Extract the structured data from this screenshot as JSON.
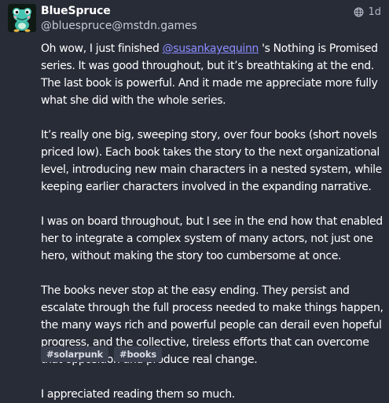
{
  "author": {
    "display_name": "BlueSpruce",
    "handle": "@bluespruce@mstdn.games",
    "avatar_icon": "frog-creature-avatar"
  },
  "meta": {
    "visibility_icon": "globe-icon",
    "relative_time": "1d"
  },
  "post": {
    "p1_before": "Oh wow, I just finished ",
    "p1_mention": "@susankayequinn",
    "p1_after": " 's Nothing is Promised series. It was good throughout, but it’s breathtaking at the end. The last book is powerful. And it made me appreciate more fully what she did with the whole series.",
    "p2": "It’s really one big, sweeping story, over four books (short novels priced low). Each book takes the story to the next organizational level, introducing new main characters in a nested system, while keeping earlier characters involved in the expanding narrative.",
    "p3": "I was on board throughout, but I see in the end how that enabled her to integrate a complex system of many actors, not just one hero, without making the story too cumbersome at once.",
    "p4": "The books never stop at the easy ending. They persist and escalate through the full process needed to make things happen, the many ways rich and powerful people can derail even hopeful progress, and the collective, tireless efforts that can overcome that opposition and produce real change.",
    "p5": "I appreciated reading them so much."
  },
  "hashtags": [
    "#solarpunk",
    "#books"
  ],
  "colors": {
    "background": "#282c37",
    "mention": "#8c8dff",
    "tag_background": "#3a3f4d"
  }
}
